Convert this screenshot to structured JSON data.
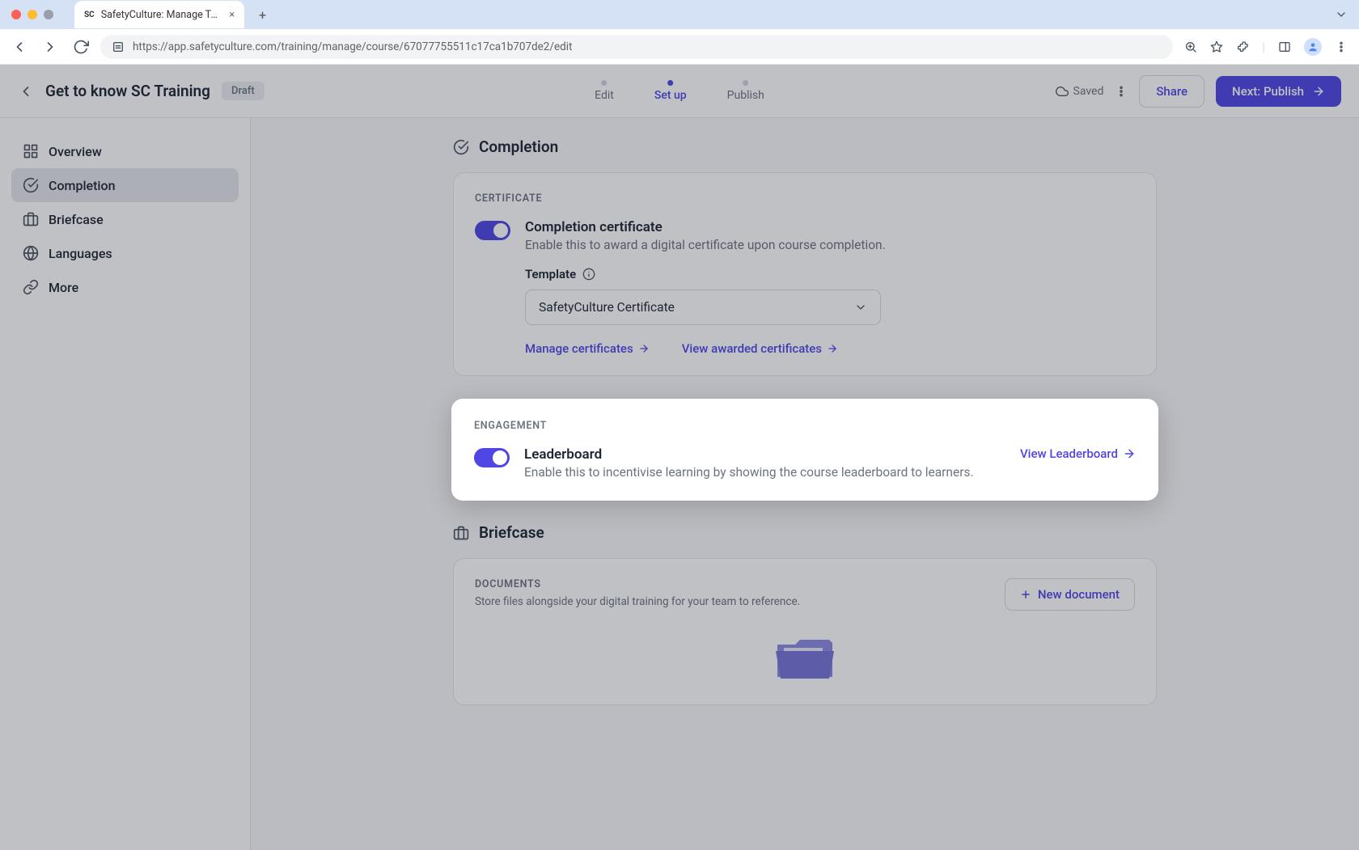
{
  "browser": {
    "tab_title": "SafetyCulture: Manage Teams and...",
    "url": "https://app.safetyculture.com/training/manage/course/67077755511c17ca1b707de2/edit"
  },
  "header": {
    "title": "Get to know SC Training",
    "badge": "Draft",
    "steps": [
      "Edit",
      "Set up",
      "Publish"
    ],
    "saved": "Saved",
    "share": "Share",
    "publish": "Next: Publish"
  },
  "sidebar": {
    "items": [
      {
        "label": "Overview"
      },
      {
        "label": "Completion"
      },
      {
        "label": "Briefcase"
      },
      {
        "label": "Languages"
      },
      {
        "label": "More"
      }
    ]
  },
  "completion": {
    "section": "Completion",
    "card_label": "CERTIFICATE",
    "toggle_title": "Completion certificate",
    "toggle_desc": "Enable this to award a digital certificate upon course completion.",
    "template_label": "Template",
    "select_value": "SafetyCulture Certificate",
    "link_manage": "Manage certificates",
    "link_view": "View awarded certificates"
  },
  "engagement": {
    "card_label": "ENGAGEMENT",
    "toggle_title": "Leaderboard",
    "toggle_desc": "Enable this to incentivise learning by showing the course leaderboard to learners.",
    "view_link": "View Leaderboard"
  },
  "briefcase": {
    "section": "Briefcase",
    "card_label": "DOCUMENTS",
    "desc": "Store files alongside your digital training for your team to reference.",
    "new_doc": "New document"
  }
}
